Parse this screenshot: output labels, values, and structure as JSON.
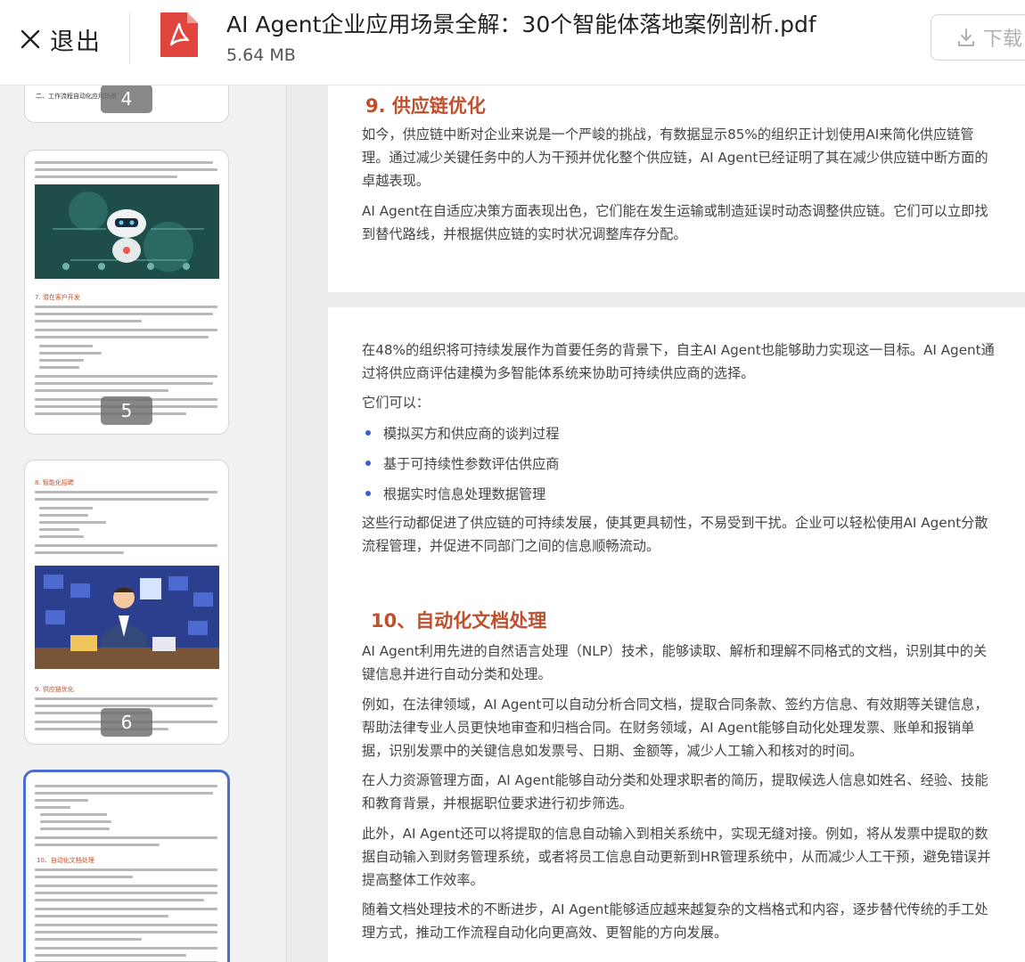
{
  "header": {
    "exit_label": "退出",
    "file_name": "AI Agent企业应用场景全解：30个智能体落地案例剖析.pdf",
    "file_size": "5.64 MB",
    "download_label": "下载"
  },
  "sidebar": {
    "thumbs": [
      {
        "page": "4",
        "heading": "二、工作流程自动化应用场景"
      },
      {
        "page": "5",
        "heading": "7. 潜在客户开发"
      },
      {
        "page": "6",
        "heading_a": "8. 智能化招聘",
        "heading_b": "9. 供应链优化"
      },
      {
        "page": "",
        "heading": "10、自动化文档处理"
      }
    ]
  },
  "document": {
    "section9_title": "9. 供应链优化",
    "section9_p1": "如今，供应链中断对企业来说是一个严峻的挑战，有数据显示85%的组织正计划使用AI来简化供应链管理。通过减少关键任务中的人为干预并优化整个供应链，AI Agent已经证明了其在减少供应链中断方面的卓越表现。",
    "section9_p2": "AI Agent在自适应决策方面表现出色，它们能在发生运输或制造延误时动态调整供应链。它们可以立即找到替代路线，并根据供应链的实时状况调整库存分配。",
    "page2_p1": "在48%的组织将可持续发展作为首要任务的背景下，自主AI Agent也能够助力实现这一目标。AI Agent通过将供应商评估建模为多智能体系统来协助可持续供应商的选择。",
    "page2_p2": "它们可以：",
    "bullets": [
      "模拟买方和供应商的谈判过程",
      "基于可持续性参数评估供应商",
      "根据实时信息处理数据管理"
    ],
    "page2_p3": "这些行动都促进了供应链的可持续发展，使其更具韧性，不易受到干扰。企业可以轻松使用AI Agent分散流程管理，并促进不同部门之间的信息顺畅流动。",
    "section10_title": "10、自动化文档处理",
    "section10_p1": "AI Agent利用先进的自然语言处理（NLP）技术，能够读取、解析和理解不同格式的文档，识别其中的关键信息并进行自动分类和处理。",
    "section10_p2": "例如，在法律领域，AI Agent可以自动分析合同文档，提取合同条款、签约方信息、有效期等关键信息，帮助法律专业人员更快地审查和归档合同。在财务领域，AI Agent能够自动化处理发票、账单和报销单据，识别发票中的关键信息如发票号、日期、金额等，减少人工输入和核对的时间。",
    "section10_p3": "在人力资源管理方面，AI Agent能够自动分类和处理求职者的简历，提取候选人信息如姓名、经验、技能和教育背景，并根据职位要求进行初步筛选。",
    "section10_p4": "此外，AI Agent还可以将提取的信息自动输入到相关系统中，实现无缝对接。例如，将从发票中提取的数据自动输入到财务管理系统，或者将员工信息自动更新到HR管理系统中，从而减少人工干预，避免错误并提高整体工作效率。",
    "section10_p5": "随着文档处理技术的不断进步，AI Agent能够适应越来越复杂的文档格式和内容，逐步替代传统的手工处理方式，推动工作流程自动化向更高效、更智能的方向发展。"
  },
  "colors": {
    "accent_red": "#c0502d",
    "bullet_blue": "#3b5fc7",
    "active_border": "#4a6fd1"
  },
  "icons": [
    "close-icon",
    "pdf-file-icon",
    "download-icon"
  ]
}
